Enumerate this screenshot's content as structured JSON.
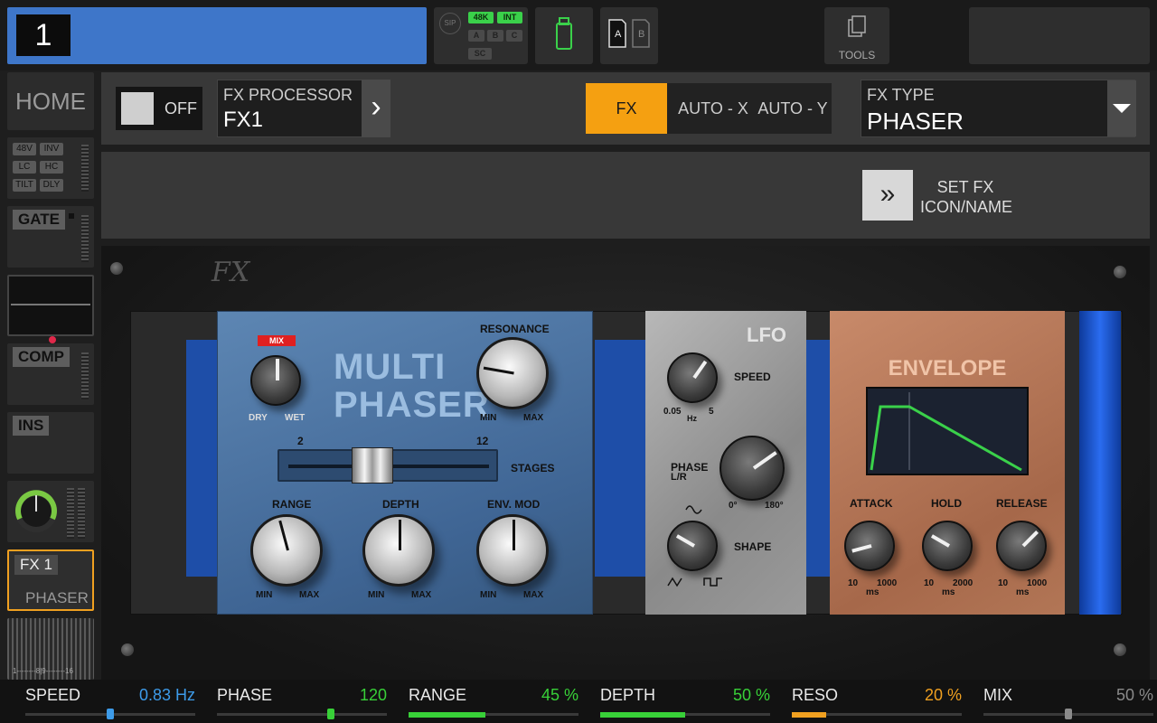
{
  "topbar": {
    "channel_number": "1",
    "sip_label": "SIP",
    "status_tags": [
      "48K",
      "INT",
      "A",
      "B",
      "C",
      "SC"
    ],
    "tools_label": "TOOLS",
    "ab": [
      "A",
      "B"
    ]
  },
  "sidebar": {
    "home_label": "HOME",
    "preamp_tags": [
      "48V",
      "INV",
      "LC",
      "HC",
      "TILT",
      "DLY"
    ],
    "gate_label": "GATE",
    "comp_label": "COMP",
    "ins_label": "INS",
    "fx_label": "FX 1",
    "fx_type": "PHASER",
    "meter_scale": "1--------8|9--------16"
  },
  "header": {
    "power_label": "OFF",
    "processor_caption": "FX PROCESSOR",
    "processor_value": "FX1",
    "modes": [
      "FX",
      "AUTO - X",
      "AUTO - Y"
    ],
    "active_mode": "FX",
    "fx_type_caption": "FX TYPE",
    "fx_type_value": "PHASER",
    "set_fx_label_1": "SET FX",
    "set_fx_label_2": "ICON/NAME"
  },
  "rack": {
    "logo": "FX",
    "phaser": {
      "title_1": "MULTI",
      "title_2": "PHASER",
      "mix_tag": "MIX",
      "mix_dry": "DRY",
      "mix_wet": "WET",
      "resonance_label": "RESONANCE",
      "min": "MIN",
      "max": "MAX",
      "stages_label": "STAGES",
      "stages_min": "2",
      "stages_max": "12",
      "range_label": "RANGE",
      "depth_label": "DEPTH",
      "envmod_label": "ENV. MOD"
    },
    "lfo": {
      "title": "LFO",
      "speed_label": "SPEED",
      "speed_min": "0.05",
      "speed_unit": "Hz",
      "speed_max": "5",
      "phase_label_1": "PHASE",
      "phase_label_2": "L/R",
      "phase_min": "0°",
      "phase_max": "180°",
      "shape_label": "SHAPE"
    },
    "envelope": {
      "title": "ENVELOPE",
      "attack_label": "ATTACK",
      "hold_label": "HOLD",
      "release_label": "RELEASE",
      "attack_min": "10",
      "attack_max": "1000",
      "hold_min": "10",
      "hold_max": "2000",
      "release_min": "10",
      "release_max": "1000",
      "unit": "ms"
    }
  },
  "params": [
    {
      "name": "SPEED",
      "value": "0.83 Hz",
      "color": "#3d9be9",
      "level": 0.5,
      "style": "thumb"
    },
    {
      "name": "PHASE",
      "value": "120",
      "color": "#38d038",
      "level": 0.67,
      "style": "thumb"
    },
    {
      "name": "RANGE",
      "value": "45 %",
      "color": "#38d038",
      "level": 0.45,
      "style": "fill"
    },
    {
      "name": "DEPTH",
      "value": "50 %",
      "color": "#38d038",
      "level": 0.5,
      "style": "fill"
    },
    {
      "name": "RESO",
      "value": "20 %",
      "color": "#f0a020",
      "level": 0.2,
      "style": "fill"
    },
    {
      "name": "MIX",
      "value": "50 %",
      "color": "#8a8a8a",
      "level": 0.5,
      "style": "thumb"
    }
  ]
}
